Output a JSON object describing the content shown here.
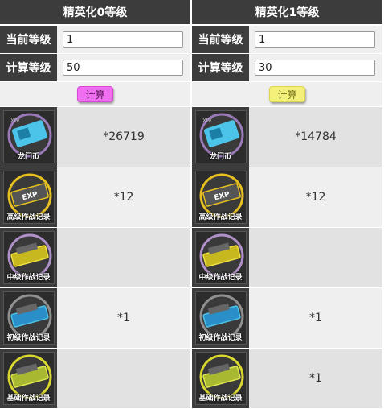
{
  "columns": [
    {
      "header": "精英化0等级",
      "current_label": "当前等级",
      "current_value": "1",
      "target_label": "计算等级",
      "target_value": "50",
      "calc_label": "计算",
      "calc_color": "#f06ef0",
      "items": [
        {
          "name": "龙门币",
          "icon": "lmb-icon",
          "value": "*26719"
        },
        {
          "name": "高级作战记录",
          "icon": "advanced-record-icon",
          "value": "*12"
        },
        {
          "name": "中级作战记录",
          "icon": "intermediate-record-icon",
          "value": ""
        },
        {
          "name": "初级作战记录",
          "icon": "primary-record-icon",
          "value": "*1"
        },
        {
          "name": "基础作战记录",
          "icon": "basic-record-icon",
          "value": ""
        }
      ]
    },
    {
      "header": "精英化1等级",
      "current_label": "当前等级",
      "current_value": "1",
      "target_label": "计算等级",
      "target_value": "30",
      "calc_label": "计算",
      "calc_color": "#f4f07a",
      "items": [
        {
          "name": "龙门币",
          "icon": "lmb-icon",
          "value": "*14784"
        },
        {
          "name": "高级作战记录",
          "icon": "advanced-record-icon",
          "value": "*12"
        },
        {
          "name": "中级作战记录",
          "icon": "intermediate-record-icon",
          "value": ""
        },
        {
          "name": "初级作战记录",
          "icon": "primary-record-icon",
          "value": "*1"
        },
        {
          "name": "基础作战记录",
          "icon": "basic-record-icon",
          "value": "*1"
        }
      ]
    }
  ]
}
